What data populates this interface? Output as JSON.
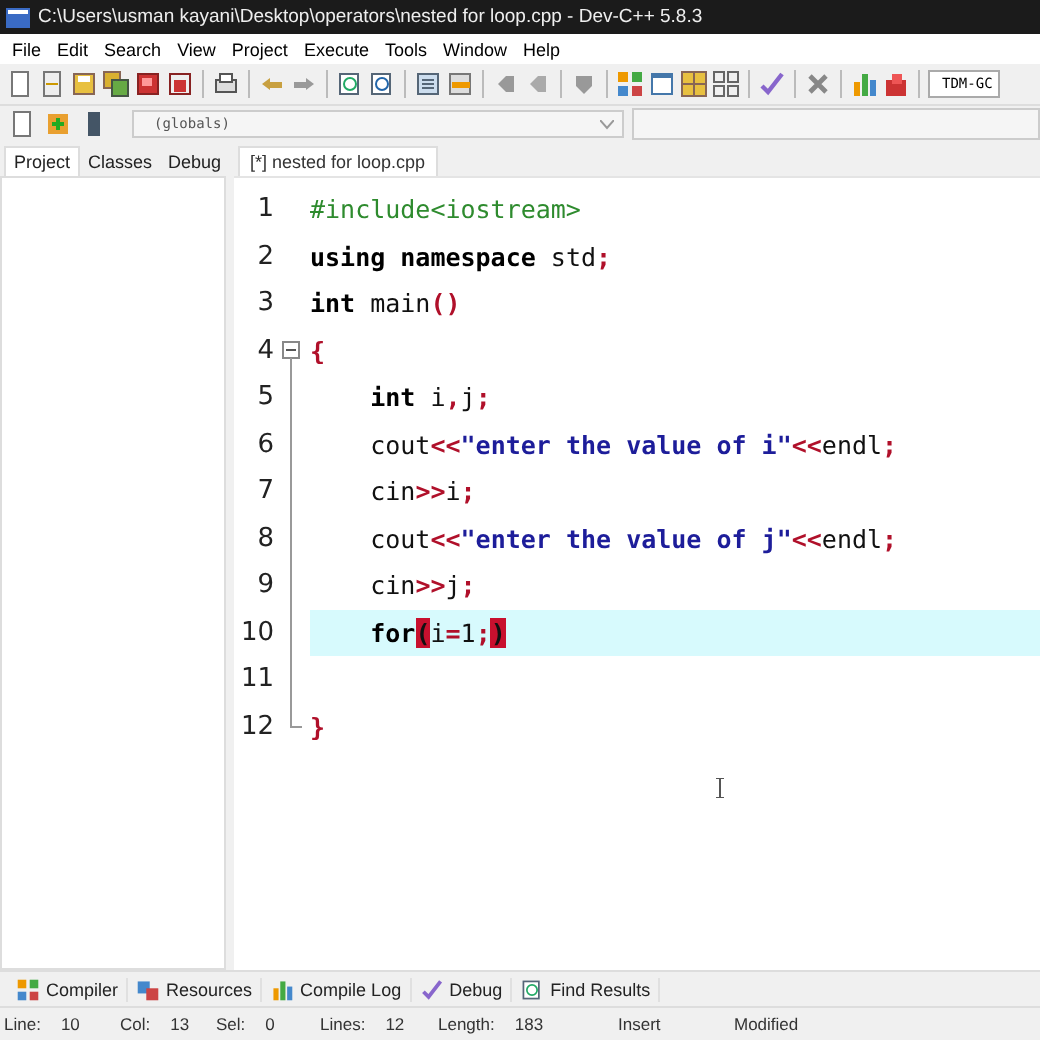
{
  "window": {
    "title": "C:\\Users\\usman kayani\\Desktop\\operators\\nested for loop.cpp - Dev-C++ 5.8.3"
  },
  "menu": [
    "File",
    "Edit",
    "Search",
    "View",
    "Project",
    "Execute",
    "Tools",
    "Window",
    "Help"
  ],
  "toolbar": {
    "compiler_combo": "TDM-GC"
  },
  "scope_bar": {
    "combo": "(globals)"
  },
  "side_tabs": [
    {
      "label": "Project",
      "selected": true
    },
    {
      "label": "Classes",
      "selected": false
    },
    {
      "label": "Debug",
      "selected": false
    }
  ],
  "editor_tabs": [
    {
      "label": "[*] nested for loop.cpp",
      "selected": true
    }
  ],
  "code": [
    {
      "number": "1",
      "current": false,
      "tokens": [
        {
          "kind": "preproc",
          "text": "#include<iostream>"
        }
      ]
    },
    {
      "number": "2",
      "current": false,
      "tokens": [
        {
          "kind": "keyword",
          "text": "using namespace"
        },
        {
          "kind": "plain",
          "text": " std"
        },
        {
          "kind": "symbol",
          "text": ";"
        }
      ]
    },
    {
      "number": "3",
      "current": false,
      "tokens": [
        {
          "kind": "keyword",
          "text": "int"
        },
        {
          "kind": "plain",
          "text": " main"
        },
        {
          "kind": "symbol",
          "text": "()"
        }
      ]
    },
    {
      "number": "4",
      "current": false,
      "tokens": [
        {
          "kind": "symbol",
          "text": "{"
        }
      ]
    },
    {
      "number": "5",
      "current": false,
      "tokens": [
        {
          "kind": "keyword",
          "text": "    int"
        },
        {
          "kind": "plain",
          "text": " i"
        },
        {
          "kind": "symbol",
          "text": ","
        },
        {
          "kind": "plain",
          "text": "j"
        },
        {
          "kind": "symbol",
          "text": ";"
        }
      ]
    },
    {
      "number": "6",
      "current": false,
      "tokens": [
        {
          "kind": "plain",
          "text": "    cout"
        },
        {
          "kind": "symbol",
          "text": "<<"
        },
        {
          "kind": "string",
          "text": "\"enter the value of i\""
        },
        {
          "kind": "symbol",
          "text": "<<"
        },
        {
          "kind": "plain",
          "text": "endl"
        },
        {
          "kind": "symbol",
          "text": ";"
        }
      ]
    },
    {
      "number": "7",
      "current": false,
      "tokens": [
        {
          "kind": "plain",
          "text": "    cin"
        },
        {
          "kind": "symbol",
          "text": ">>"
        },
        {
          "kind": "plain",
          "text": "i"
        },
        {
          "kind": "symbol",
          "text": ";"
        }
      ]
    },
    {
      "number": "8",
      "current": false,
      "tokens": [
        {
          "kind": "plain",
          "text": "    cout"
        },
        {
          "kind": "symbol",
          "text": "<<"
        },
        {
          "kind": "string",
          "text": "\"enter the value of j\""
        },
        {
          "kind": "symbol",
          "text": "<<"
        },
        {
          "kind": "plain",
          "text": "endl"
        },
        {
          "kind": "symbol",
          "text": ";"
        }
      ]
    },
    {
      "number": "9",
      "current": false,
      "tokens": [
        {
          "kind": "plain",
          "text": "    cin"
        },
        {
          "kind": "symbol",
          "text": ">>"
        },
        {
          "kind": "plain",
          "text": "j"
        },
        {
          "kind": "symbol",
          "text": ";"
        }
      ]
    },
    {
      "number": "10",
      "current": true,
      "tokens": [
        {
          "kind": "keyword",
          "text": "    for"
        },
        {
          "kind": "match",
          "text": "("
        },
        {
          "kind": "plain",
          "text": "i"
        },
        {
          "kind": "symbol",
          "text": "="
        },
        {
          "kind": "plain",
          "text": "1"
        },
        {
          "kind": "symbol",
          "text": ";"
        },
        {
          "kind": "match",
          "text": ")"
        }
      ]
    },
    {
      "number": "11",
      "current": false
    },
    {
      "number": "12",
      "current": false,
      "tokens": [
        {
          "kind": "symbol",
          "text": "}"
        }
      ]
    }
  ],
  "bottom_tabs": [
    {
      "label": "Compiler"
    },
    {
      "label": "Resources"
    },
    {
      "label": "Compile Log"
    },
    {
      "label": "Debug"
    },
    {
      "label": "Find Results"
    }
  ],
  "status_bar": [
    {
      "label": "Line:",
      "value": "10"
    },
    {
      "label": "Col:",
      "value": "13"
    },
    {
      "label": "Sel:",
      "value": "0"
    },
    {
      "label": "Lines:",
      "value": "12"
    },
    {
      "label": "Length:",
      "value": "183"
    },
    {
      "label": "Insert"
    },
    {
      "label": "Modified"
    }
  ]
}
